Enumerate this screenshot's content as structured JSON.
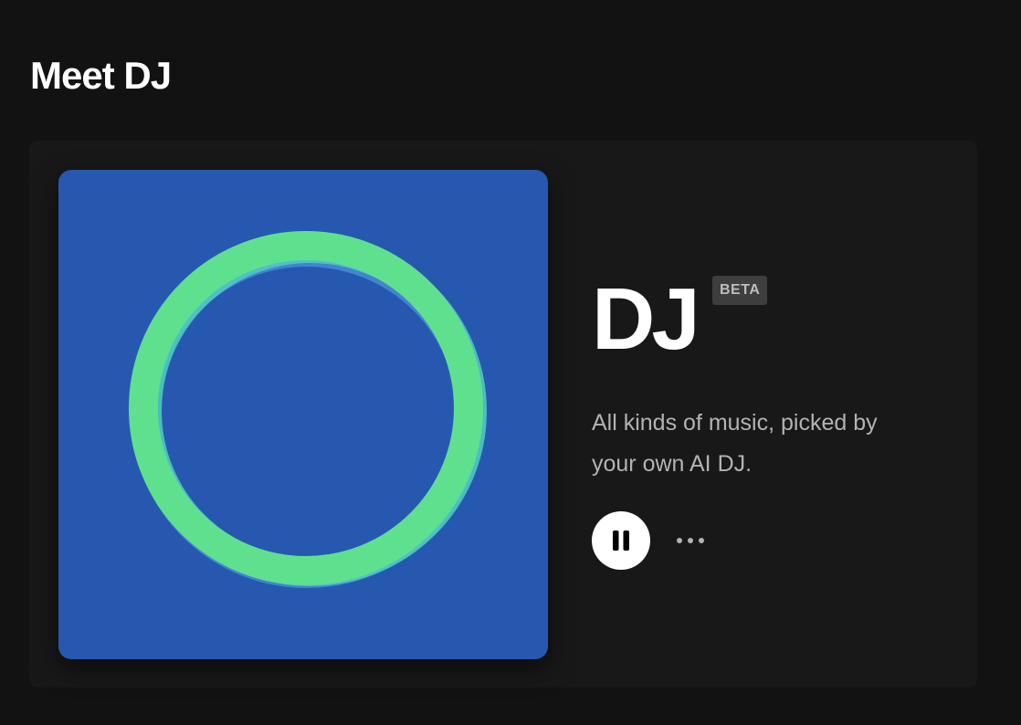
{
  "section": {
    "title": "Meet DJ"
  },
  "card": {
    "title": "DJ",
    "badge": "BETA",
    "description": "All kinds of music, picked by your own AI DJ.",
    "artwork": {
      "background_color": "#2758B0",
      "ring_colors": [
        "#5FE08F",
        "#4FC9C4",
        "#4A8BD8"
      ]
    },
    "controls": {
      "pause_icon": "pause-icon",
      "more_icon": "more-options-icon"
    }
  },
  "colors": {
    "page_background": "#121212",
    "card_background": "#181818",
    "text_primary": "#FFFFFF",
    "text_secondary": "#B3B3B3",
    "badge_background": "#3E3E3E"
  }
}
